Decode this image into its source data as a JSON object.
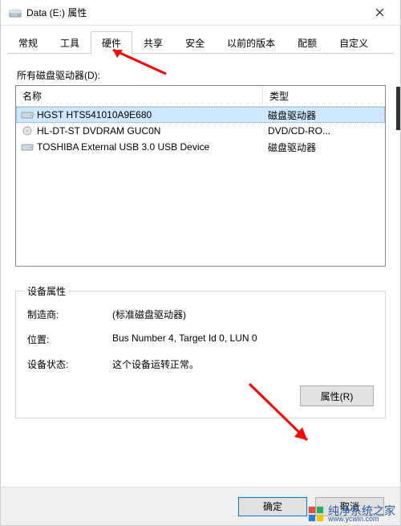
{
  "window": {
    "title": "Data (E:) 属性"
  },
  "tabs": [
    {
      "label": "常规"
    },
    {
      "label": "工具"
    },
    {
      "label": "硬件"
    },
    {
      "label": "共享"
    },
    {
      "label": "安全"
    },
    {
      "label": "以前的版本"
    },
    {
      "label": "配额"
    },
    {
      "label": "自定义"
    }
  ],
  "active_tab_index": 2,
  "drives_label": "所有磁盘驱动器(D):",
  "list": {
    "columns": {
      "name": "名称",
      "type": "类型"
    },
    "rows": [
      {
        "name": "HGST HTS541010A9E680",
        "type": "磁盘驱动器",
        "icon": "hdd",
        "selected": true
      },
      {
        "name": "HL-DT-ST DVDRAM GUC0N",
        "type": "DVD/CD-RO...",
        "icon": "optical",
        "selected": false
      },
      {
        "name": "TOSHIBA External USB 3.0 USB Device",
        "type": "磁盘驱动器",
        "icon": "hdd",
        "selected": false
      }
    ]
  },
  "device_props": {
    "legend": "设备属性",
    "manufacturer_label": "制造商:",
    "manufacturer_value": "(标准磁盘驱动器)",
    "location_label": "位置:",
    "location_value": "Bus Number 4, Target Id 0, LUN 0",
    "status_label": "设备状态:",
    "status_value": "这个设备运转正常。",
    "properties_button": "属性(R)"
  },
  "footer": {
    "ok": "确定",
    "cancel": "取消"
  },
  "watermark": {
    "main": "纯净系统之家",
    "sub": "www.ycwin.com"
  }
}
